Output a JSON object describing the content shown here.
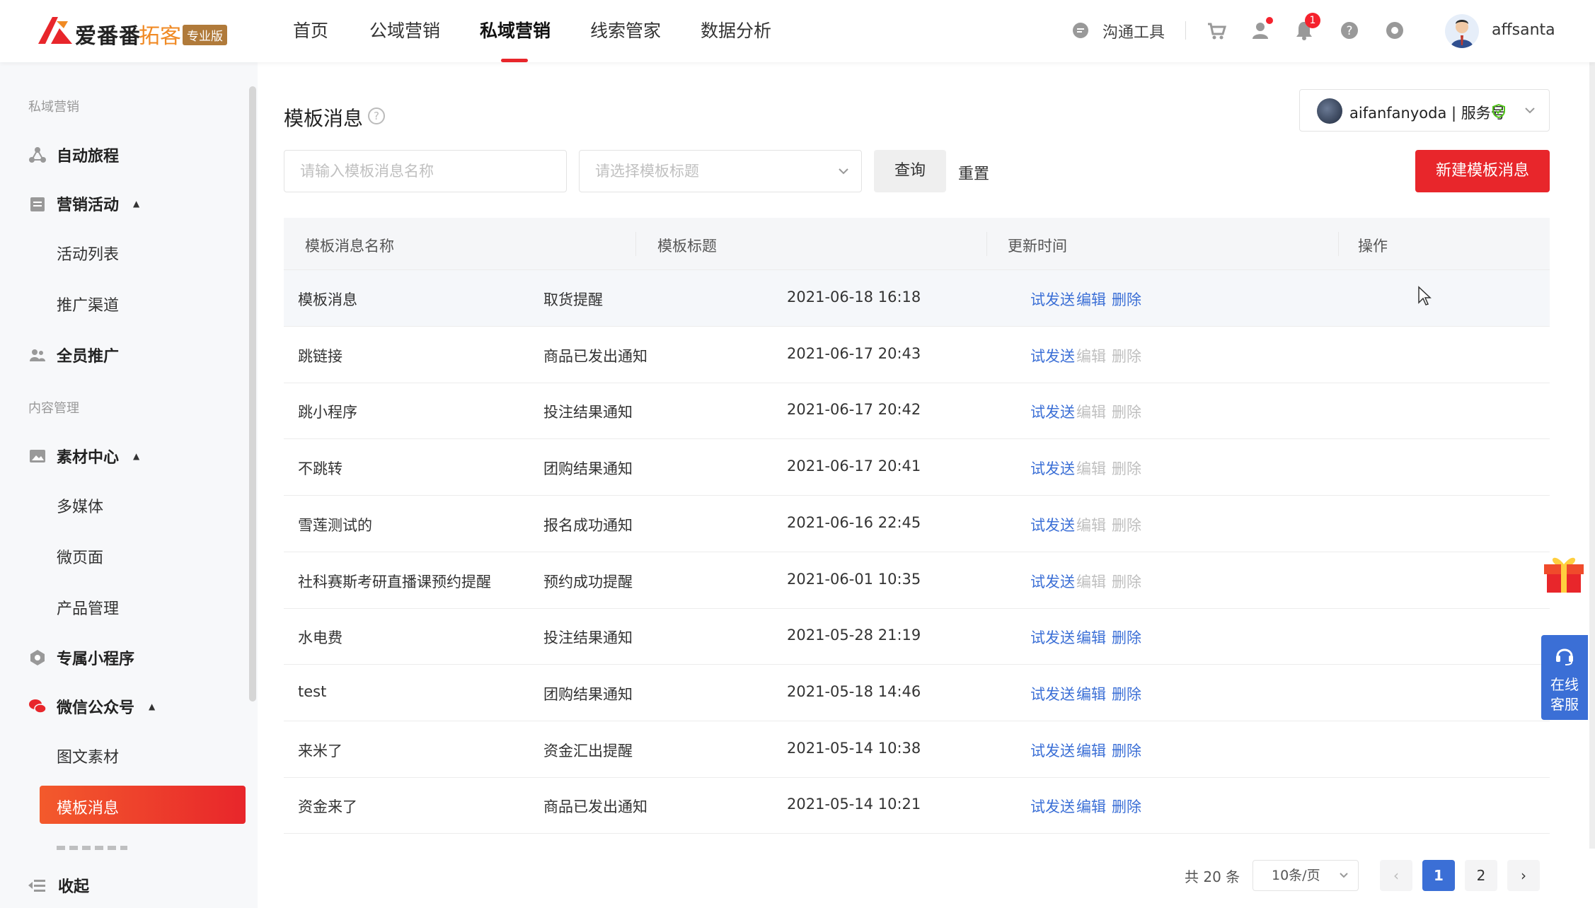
{
  "header": {
    "logo_text": "爱番番",
    "logo_sub": "拓客",
    "logo_badge": "专业版",
    "nav": [
      "首页",
      "公域营销",
      "私域营销",
      "线索管家",
      "数据分析"
    ],
    "nav_active_index": 2,
    "tool_label": "沟通工具",
    "notification_count": "1",
    "username": "affsanta"
  },
  "sidebar": {
    "sections": [
      {
        "label": "私域营销"
      },
      {
        "label": "内容管理"
      }
    ],
    "items": {
      "auto_journey": "自动旅程",
      "marketing_activity": "营销活动",
      "activity_list": "活动列表",
      "promo_channel": "推广渠道",
      "all_staff": "全员推广",
      "material_center": "素材中心",
      "multimedia": "多媒体",
      "micro_page": "微页面",
      "product_mgmt": "产品管理",
      "mini_program": "专属小程序",
      "wechat_oa": "微信公众号",
      "image_text": "图文素材",
      "template_msg": "模板消息"
    },
    "collapse_label": "收起"
  },
  "main": {
    "title": "模板消息",
    "account": "aifanfanyoda | 服务号",
    "search": {
      "name_placeholder": "请输入模板消息名称",
      "title_placeholder": "请选择模板标题",
      "query_label": "查询",
      "reset_label": "重置",
      "new_label": "新建模板消息"
    },
    "table": {
      "columns": [
        "模板消息名称",
        "模板标题",
        "更新时间",
        "操作"
      ],
      "actions": {
        "send": "试发送",
        "edit": "编辑",
        "delete": "删除"
      },
      "rows": [
        {
          "name": "模板消息",
          "title": "取货提醒",
          "time": "2021-06-18 16:18",
          "editable": true
        },
        {
          "name": "跳链接",
          "title": "商品已发出通知",
          "time": "2021-06-17 20:43",
          "editable": false
        },
        {
          "name": "跳小程序",
          "title": "投注结果通知",
          "time": "2021-06-17 20:42",
          "editable": false
        },
        {
          "name": "不跳转",
          "title": "团购结果通知",
          "time": "2021-06-17 20:41",
          "editable": false
        },
        {
          "name": "雪莲测试的",
          "title": "报名成功通知",
          "time": "2021-06-16 22:45",
          "editable": false
        },
        {
          "name": "社科赛斯考研直播课预约提醒",
          "title": "预约成功提醒",
          "time": "2021-06-01 10:35",
          "editable": false
        },
        {
          "name": "水电费",
          "title": "投注结果通知",
          "time": "2021-05-28 21:19",
          "editable": true
        },
        {
          "name": "test",
          "title": "团购结果通知",
          "time": "2021-05-18 14:46",
          "editable": true
        },
        {
          "name": "来米了",
          "title": "资金汇出提醒",
          "time": "2021-05-14 10:38",
          "editable": true
        },
        {
          "name": "资金来了",
          "title": "商品已发出通知",
          "time": "2021-05-14 10:21",
          "editable": true
        }
      ]
    },
    "pagination": {
      "total": "共 20 条",
      "page_size": "10条/页",
      "pages": [
        "1",
        "2"
      ],
      "current": "1"
    }
  },
  "float": {
    "service_label_1": "在线",
    "service_label_2": "客服"
  },
  "colors": {
    "brand_red": "#e8262b",
    "link_blue": "#3b6fd6",
    "disabled": "#bfbfbf"
  }
}
